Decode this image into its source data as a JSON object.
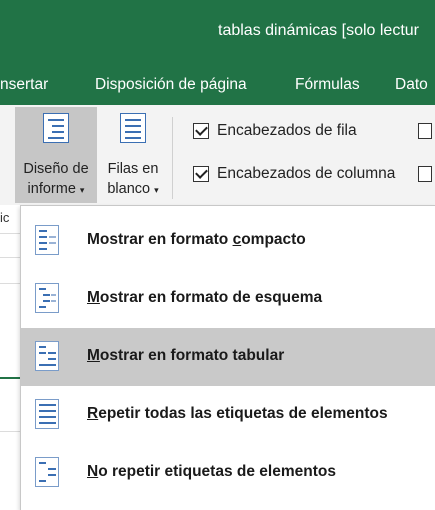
{
  "window": {
    "title": "tablas dinámicas  [solo lectur"
  },
  "tabs": [
    "nsertar",
    "Disposición de página",
    "Fórmulas",
    "Dato"
  ],
  "ribbon": {
    "report_layout": {
      "line1": "Diseño de",
      "line2": "informe",
      "caret": "▾"
    },
    "blank_rows": {
      "line1": "Filas en",
      "line2": "blanco",
      "caret": "▾"
    },
    "row_headers": {
      "label": "Encabezados de fila",
      "checked": true
    },
    "column_headers": {
      "label": "Encabezados de columna",
      "checked": true
    }
  },
  "sheet": {
    "left_mark": "ic"
  },
  "menu": {
    "items": [
      {
        "pre": "Mostrar en formato ",
        "accel": "c",
        "post": "ompacto",
        "icon": "compact-layout-icon",
        "highlighted": false
      },
      {
        "pre": "",
        "accel": "M",
        "post": "ostrar en formato de esquema",
        "icon": "outline-layout-icon",
        "highlighted": false
      },
      {
        "pre": "",
        "accel": "M",
        "post": "ostrar en formato tabular",
        "icon": "tabular-layout-icon",
        "highlighted": true
      },
      {
        "pre": "",
        "accel": "R",
        "post": "epetir todas las etiquetas de elementos",
        "icon": "repeat-labels-icon",
        "highlighted": false
      },
      {
        "pre": "",
        "accel": "N",
        "post": "o repetir etiquetas de elementos",
        "icon": "no-repeat-labels-icon",
        "highlighted": false
      }
    ]
  },
  "colors": {
    "excel_green": "#217346",
    "ribbon_bg": "#f3f3f3",
    "highlight": "#c9c9c9",
    "icon_blue": "#3b6fb3"
  }
}
